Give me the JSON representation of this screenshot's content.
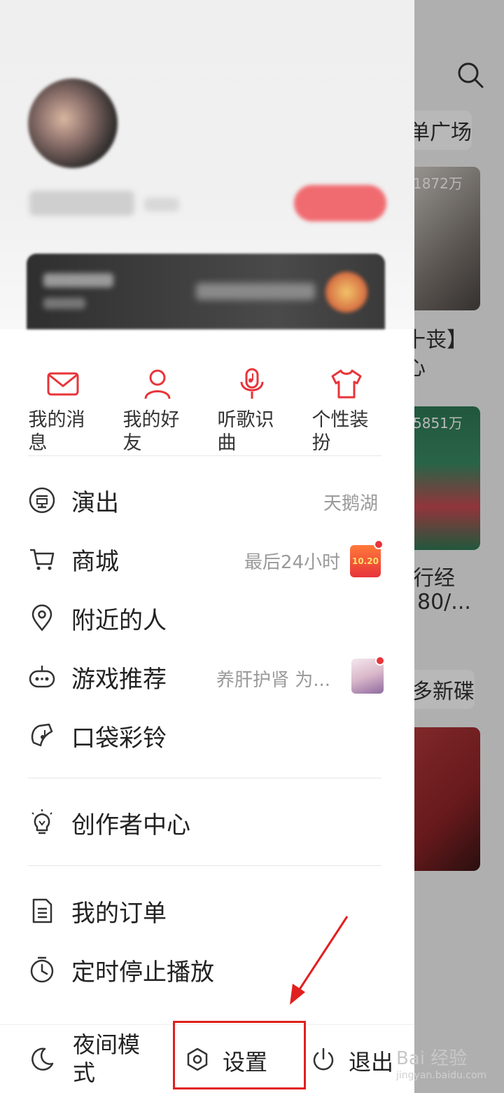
{
  "background": {
    "texts": [
      "单广场",
      "1872万",
      "十丧】",
      "心",
      "5851万",
      "行经",
      "80/...",
      "多新碟"
    ]
  },
  "quick_actions": [
    {
      "label": "我的消息",
      "icon": "mail-icon"
    },
    {
      "label": "我的好友",
      "icon": "user-icon"
    },
    {
      "label": "听歌识曲",
      "icon": "mic-music-icon"
    },
    {
      "label": "个性装扮",
      "icon": "tshirt-icon"
    }
  ],
  "menu": {
    "shows": {
      "label": "演出",
      "extra": "天鹅湖",
      "icon": "ticket-icon"
    },
    "mall": {
      "label": "商城",
      "extra": "最后24小时",
      "icon": "cart-icon",
      "badge_text": "10.20"
    },
    "nearby": {
      "label": "附近的人",
      "icon": "location-icon"
    },
    "games": {
      "label": "游戏推荐",
      "extra": "养肝护肾 为...",
      "icon": "gamepad-icon"
    },
    "ringtone": {
      "label": "口袋彩铃",
      "icon": "ringtone-icon"
    },
    "creator": {
      "label": "创作者中心",
      "icon": "bulb-icon"
    },
    "orders": {
      "label": "我的订单",
      "icon": "document-icon"
    },
    "timer": {
      "label": "定时停止播放",
      "icon": "timer-icon"
    }
  },
  "bottom_bar": {
    "night_mode": "夜间模式",
    "settings": "设置",
    "logout": "退出"
  },
  "watermark": {
    "text": "Bai 经验",
    "url": "jingyan.baidu.com"
  },
  "colors": {
    "accent": "#e8343a",
    "highlight": "#e11f1f"
  }
}
